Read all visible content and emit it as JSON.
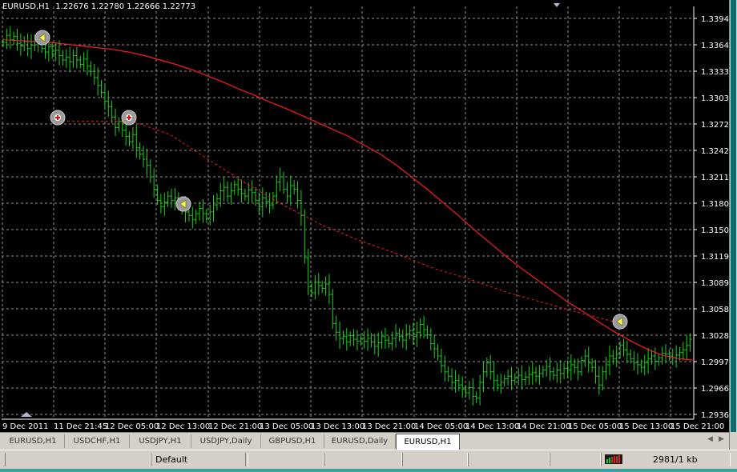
{
  "chart_header": {
    "symbol_timeframe": "EURUSD,H1",
    "ohlc": "1.22676 1.22780 1.22666 1.22773"
  },
  "colors": {
    "background": "#000000",
    "grid": "#8f8f8f",
    "candle": "#16d31f",
    "moving_average": "#ff1a1a",
    "signal_marker": "#9a9a9a",
    "axis_text": "#ffffff"
  },
  "price_axis": {
    "labels": [
      "1.33945",
      "1.33640",
      "1.33335",
      "1.33030",
      "1.32725",
      "1.32420",
      "1.32115",
      "1.31805",
      "1.31500",
      "1.31195",
      "1.30890",
      "1.30585",
      "1.30280",
      "1.29975",
      "1.29665",
      "1.29360"
    ]
  },
  "time_axis": {
    "labels": [
      "9 Dec 2011",
      "11 Dec 21:45",
      "12 Dec 05:00",
      "12 Dec 13:00",
      "12 Dec 21:00",
      "13 Dec 05:00",
      "13 Dec 13:00",
      "13 Dec 21:00",
      "14 Dec 05:00",
      "14 Dec 13:00",
      "14 Dec 21:00",
      "15 Dec 05:00",
      "15 Dec 13:00",
      "15 Dec 21:00"
    ]
  },
  "chart_data": {
    "type": "line",
    "title": "",
    "ylim": [
      1.2936,
      1.3406
    ],
    "grid": true,
    "series": [
      {
        "kind": "close",
        "values": [
          1.3365,
          1.3373,
          1.3368,
          1.3372,
          1.3364,
          1.3361,
          1.3366,
          1.3358,
          1.3362,
          1.3367,
          1.3364,
          1.3358,
          1.3354,
          1.336,
          1.3352,
          1.3356,
          1.335,
          1.3345,
          1.3348,
          1.3343,
          1.335,
          1.3345,
          1.334,
          1.3346,
          1.3338,
          1.3332,
          1.3325,
          1.3316,
          1.3308,
          1.3298,
          1.3292,
          1.328,
          1.3268,
          1.3275,
          1.3265,
          1.3258,
          1.3252,
          1.326,
          1.3245,
          1.3238,
          1.3232,
          1.3225,
          1.3212,
          1.3198,
          1.3185,
          1.3178,
          1.3183,
          1.319,
          1.3185,
          1.3188,
          1.318,
          1.3178,
          1.3172,
          1.3168,
          1.3163,
          1.317,
          1.3176,
          1.317,
          1.3165,
          1.3172,
          1.318,
          1.3187,
          1.3196,
          1.32,
          1.319,
          1.3196,
          1.3203,
          1.3198,
          1.3193,
          1.319,
          1.3197,
          1.3194,
          1.3185,
          1.3178,
          1.3188,
          1.3184,
          1.318,
          1.319,
          1.3206,
          1.3212,
          1.3198,
          1.319,
          1.3202,
          1.3198,
          1.3185,
          1.3168,
          1.312,
          1.3087,
          1.308,
          1.3092,
          1.3088,
          1.3085,
          1.309,
          1.3078,
          1.3045,
          1.3035,
          1.3028,
          1.303,
          1.3024,
          1.3031,
          1.3027,
          1.3025,
          1.3028,
          1.3025,
          1.3028,
          1.3024,
          1.3019,
          1.3023,
          1.303,
          1.3026,
          1.3022,
          1.3028,
          1.3034,
          1.303,
          1.3026,
          1.3033,
          1.3037,
          1.303,
          1.3035,
          1.3044,
          1.3038,
          1.3032,
          1.3022,
          1.3016,
          1.3008,
          1.2997,
          1.299,
          1.2985,
          1.2978,
          1.298,
          1.2975,
          1.297,
          1.2966,
          1.2972,
          1.2962,
          1.296,
          1.2978,
          1.299,
          1.3,
          1.299,
          1.298,
          1.2975,
          1.2978,
          1.2982,
          1.2985,
          1.298,
          1.2983,
          1.2986,
          1.2981,
          1.2984,
          1.2987,
          1.2989,
          1.2985,
          1.2988,
          1.2992,
          1.2996,
          1.299,
          1.2986,
          1.2992,
          1.2988,
          1.2994,
          1.2992,
          1.2998,
          1.2995,
          1.299,
          1.3003,
          1.3008,
          1.3,
          1.2995,
          1.2985,
          1.2975,
          1.299,
          1.2998,
          1.3008,
          1.3005,
          1.301,
          1.302,
          1.3015,
          1.301,
          1.3005,
          1.3,
          1.2998,
          1.2995,
          1.3,
          1.3005,
          1.3008,
          1.3002,
          1.3006,
          1.3011,
          1.301,
          1.3008,
          1.3006,
          1.3009,
          1.3012,
          1.3015,
          1.302,
          1.3027
        ]
      },
      {
        "kind": "moving_average",
        "values": [
          1.3368,
          1.3367,
          1.3366,
          1.3365,
          1.3363,
          1.3361,
          1.3359,
          1.3357,
          1.3354,
          1.335,
          1.3345,
          1.334,
          1.3334,
          1.3327,
          1.332,
          1.3312,
          1.3305,
          1.3297,
          1.329,
          1.3282,
          1.3274,
          1.3266,
          1.3258,
          1.3248,
          1.3238,
          1.3226,
          1.3212,
          1.3198,
          1.3183,
          1.3168,
          1.3152,
          1.3137,
          1.3122,
          1.3108,
          1.3095,
          1.3082,
          1.3069,
          1.3058,
          1.3046,
          1.3035,
          1.3025,
          1.3016,
          1.3009,
          1.3005,
          1.3003
        ]
      }
    ],
    "dotted_signal_line": [
      1.3275,
      1.3275,
      1.3275,
      1.326,
      1.3232,
      1.3205,
      1.318,
      1.3158,
      1.314,
      1.3125,
      1.3108,
      1.3095,
      1.308,
      1.3068,
      1.3056,
      1.3045
    ]
  },
  "signals": [
    {
      "type": "sell",
      "icon": "triangle-left"
    },
    {
      "type": "buy",
      "icon": "cross"
    },
    {
      "type": "buy",
      "icon": "cross"
    },
    {
      "type": "sell",
      "icon": "triangle-left"
    },
    {
      "type": "sell",
      "icon": "triangle-left"
    }
  ],
  "tabs": [
    {
      "label": "EURUSD,H1",
      "active": false
    },
    {
      "label": "USDCHF,H1",
      "active": false
    },
    {
      "label": "USDJPY,H1",
      "active": false
    },
    {
      "label": "USDJPY,Daily",
      "active": false
    },
    {
      "label": "GBPUSD,H1",
      "active": false
    },
    {
      "label": "EURUSD,Daily",
      "active": false
    },
    {
      "label": "EURUSD,H1",
      "active": true
    }
  ],
  "statusbar": {
    "profile": "Default",
    "traffic": "2981/1 kb"
  }
}
